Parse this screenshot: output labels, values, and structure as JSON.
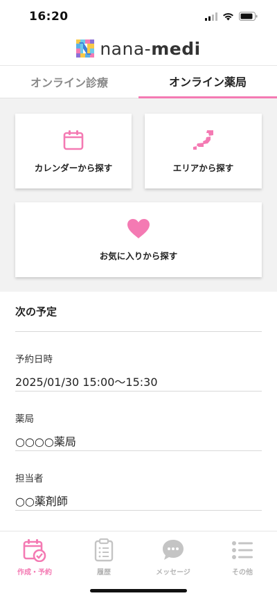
{
  "status": {
    "time": "16:20"
  },
  "logo": {
    "brand_light": "nana-",
    "brand_bold": "medi"
  },
  "tabs": [
    {
      "label": "オンライン診療",
      "active": false
    },
    {
      "label": "オンライン薬局",
      "active": true
    }
  ],
  "search": {
    "calendar_label": "カレンダーから探す",
    "area_label": "エリアから探す",
    "favorite_label": "お気に入りから探す"
  },
  "schedule": {
    "title": "次の予定",
    "datetime_label": "予約日時",
    "datetime_value": "2025/01/30 15:00～15:30",
    "pharmacy_label": "薬局",
    "pharmacy_value": "○○○○薬局",
    "staff_label": "担当者",
    "staff_value": "○○薬剤師"
  },
  "nav": {
    "create": "作成・予約",
    "history": "履歴",
    "message": "メッセージ",
    "other": "その他"
  },
  "colors": {
    "accent": "#f47ab3",
    "inactive": "#b4b4b4",
    "panel": "#f2f2f2"
  },
  "icons": [
    "calendar-icon",
    "japan-map-icon",
    "heart-icon",
    "calendar-check-icon",
    "clipboard-icon",
    "chat-bubble-icon",
    "list-icon"
  ]
}
